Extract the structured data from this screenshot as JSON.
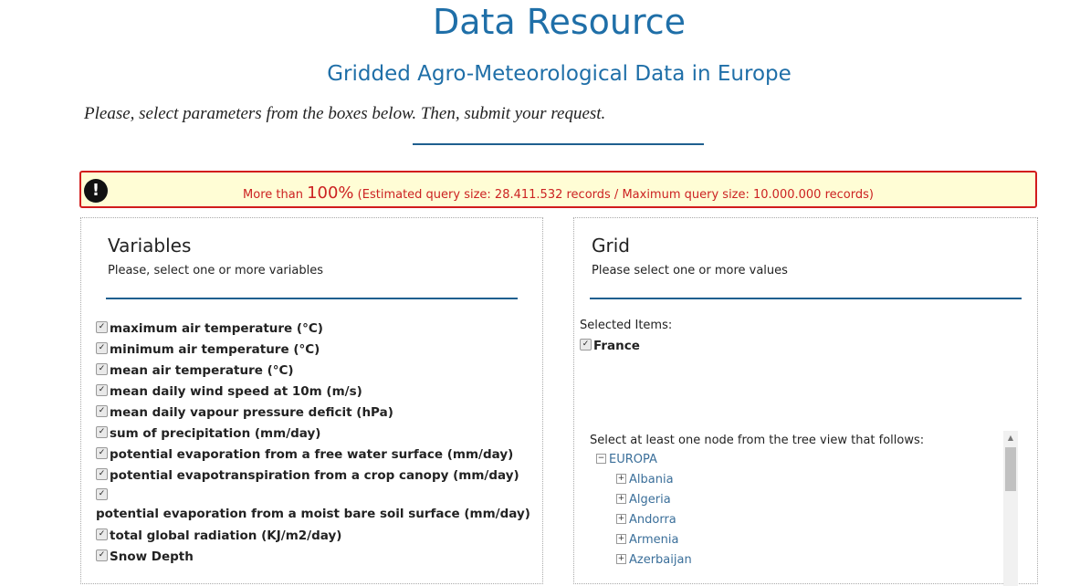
{
  "header": {
    "title": "Data Resource",
    "subtitle": "Gridded Agro-Meteorological Data in Europe",
    "instruction": "Please, select parameters from the boxes below. Then, submit your request."
  },
  "alert": {
    "prefix": "More than ",
    "percent": "100%",
    "detail": " (Estimated query size: 28.411.532 records / Maximum query size: 10.000.000 records)",
    "icon": "exclamation-icon",
    "border_color": "#d21c1c",
    "background": "#fffdd5"
  },
  "variables_panel": {
    "title": "Variables",
    "hint": "Please, select one or more variables",
    "items": [
      "maximum air temperature (°C)",
      "minimum air temperature (°C)",
      "mean air temperature (°C)",
      "mean daily wind speed at 10m (m/s)",
      "mean daily vapour pressure deficit (hPa)",
      "sum of precipitation (mm/day)",
      "potential evaporation from a free water surface (mm/day)",
      "potential evapotranspiration from a crop canopy (mm/day)",
      "potential evaporation from a moist bare soil surface (mm/day)",
      "total global radiation (KJ/m2/day)",
      "Snow Depth"
    ]
  },
  "grid_panel": {
    "title": "Grid",
    "hint": "Please select one or more values",
    "selected_label": "Selected Items:",
    "selected_items": [
      "France"
    ],
    "tree_hint": "Select at least one node from the tree view that follows:",
    "tree_root": "EUROPA",
    "tree_children": [
      "Albania",
      "Algeria",
      "Andorra",
      "Armenia",
      "Azerbaijan"
    ]
  },
  "colors": {
    "accent": "#1f6fa8",
    "rule": "#1f5f8f",
    "alert_text": "#cc2222",
    "tree_link": "#3b6f9a"
  }
}
